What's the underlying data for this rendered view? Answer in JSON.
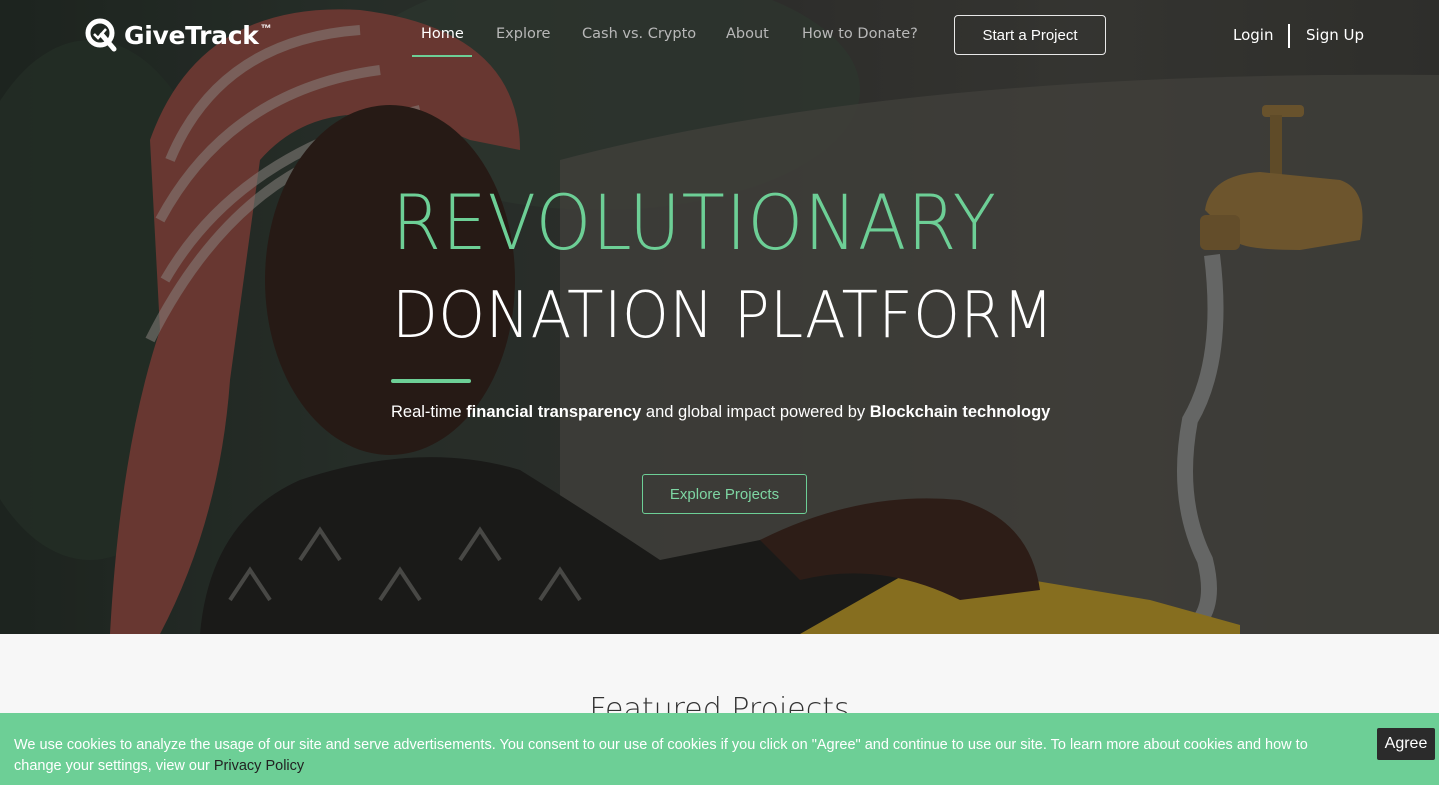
{
  "brand": {
    "name": "GiveTrack",
    "tm": "™"
  },
  "nav": {
    "items": [
      {
        "label": "Home",
        "active": true
      },
      {
        "label": "Explore"
      },
      {
        "label": "Cash vs. Crypto"
      },
      {
        "label": "About"
      },
      {
        "label": "How to Donate?"
      }
    ],
    "cta_label": "Start a Project",
    "login_label": "Login",
    "signup_label": "Sign Up"
  },
  "hero": {
    "headline_1": "REVOLUTIONARY",
    "headline_2": "DONATION PLATFORM",
    "tagline": {
      "part_1": "Real-time ",
      "bold_1": "financial transparency",
      "part_2": " and global impact powered by ",
      "bold_2": "Blockchain technology"
    },
    "cta_label": "Explore Projects"
  },
  "featured": {
    "title": "Featured Projects"
  },
  "cookie": {
    "text": "We use cookies to analyze the usage of our site and serve advertisements. You consent to our use of cookies if you click on \"Agree\" and continue to use our site. To learn more about cookies and how to change your settings, view our ",
    "link_label": "Privacy Policy",
    "agree_label": "Agree"
  },
  "colors": {
    "accent": "#6dcf96",
    "cookie_bg": "#6dcf96",
    "agree_bg": "#2b2b2b"
  }
}
